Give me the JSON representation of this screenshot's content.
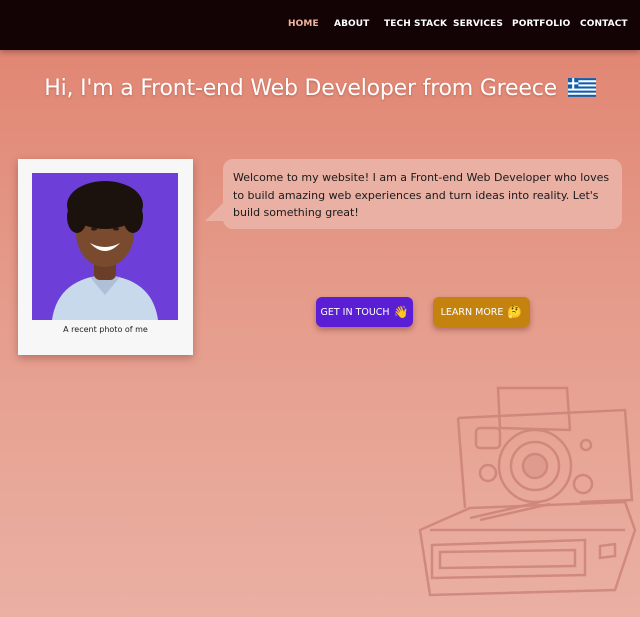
{
  "nav": {
    "items": [
      "HOME",
      "ABOUT",
      "TECH STACK",
      "SERVICES",
      "PORTFOLIO",
      "CONTACT"
    ],
    "active": "HOME"
  },
  "hero": {
    "title": "Hi, I'm a Front-end Web Developer from Greece",
    "flag_icon": "greek-flag-icon"
  },
  "photo": {
    "caption": "A recent photo of me",
    "background_color": "#6d3fd8"
  },
  "intro": {
    "text": "Welcome to my website! I am a Front-end Web Developer who loves to build amazing web experiences and turn ideas into reality. Let's build something great!"
  },
  "buttons": {
    "contact_label": "GET IN TOUCH",
    "contact_emoji": "👋",
    "learn_label": "LEARN MORE",
    "learn_emoji": "🤔"
  },
  "colors": {
    "navbar": "#140305",
    "accent_nav_active": "#f0b49e",
    "contact_button": "#5a1fd4",
    "learn_button": "#c4830f"
  }
}
